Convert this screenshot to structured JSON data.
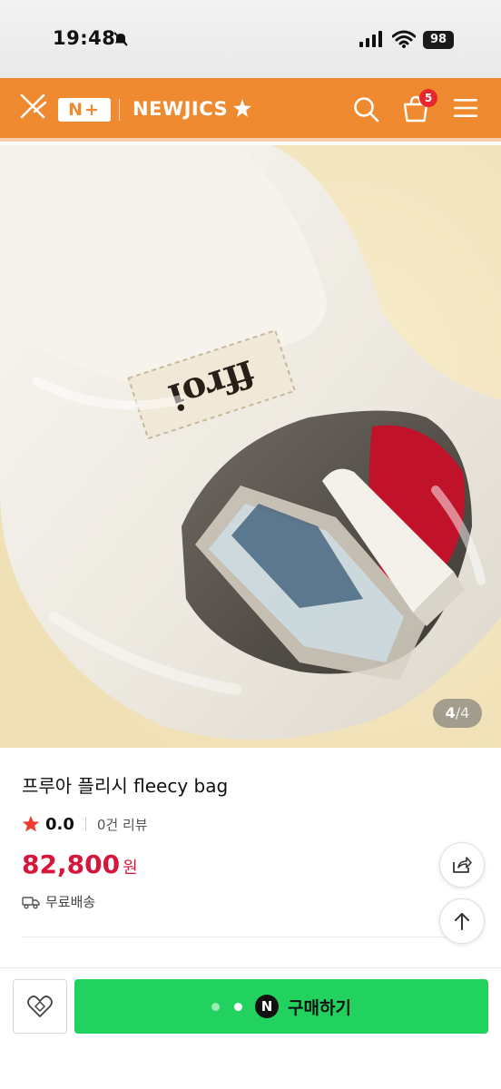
{
  "status_bar": {
    "time": "19:48",
    "battery": "98"
  },
  "header": {
    "logo_mark": "N+",
    "brand": "NEWJICS",
    "cart_count": "5",
    "accent_color": "#f08a30"
  },
  "product": {
    "image": {
      "label_text": "ffroi",
      "counter_current": "4",
      "counter_total": "/4"
    },
    "title": "프루아 플리시 fleecy bag",
    "rating": "0.0",
    "review_count": "0건 리뷰",
    "price": "82,800",
    "price_unit": "원",
    "shipping": "무료배송",
    "price_color": "#d4173a"
  },
  "icons": {
    "share": "share-icon",
    "scroll_top": "arrow-up-icon",
    "wish": "heart-icon",
    "truck": "truck-icon",
    "star": "star-icon"
  },
  "bottom_bar": {
    "pay_badge": "N",
    "buy_label": "구매하기",
    "buy_color": "#21d35e"
  }
}
